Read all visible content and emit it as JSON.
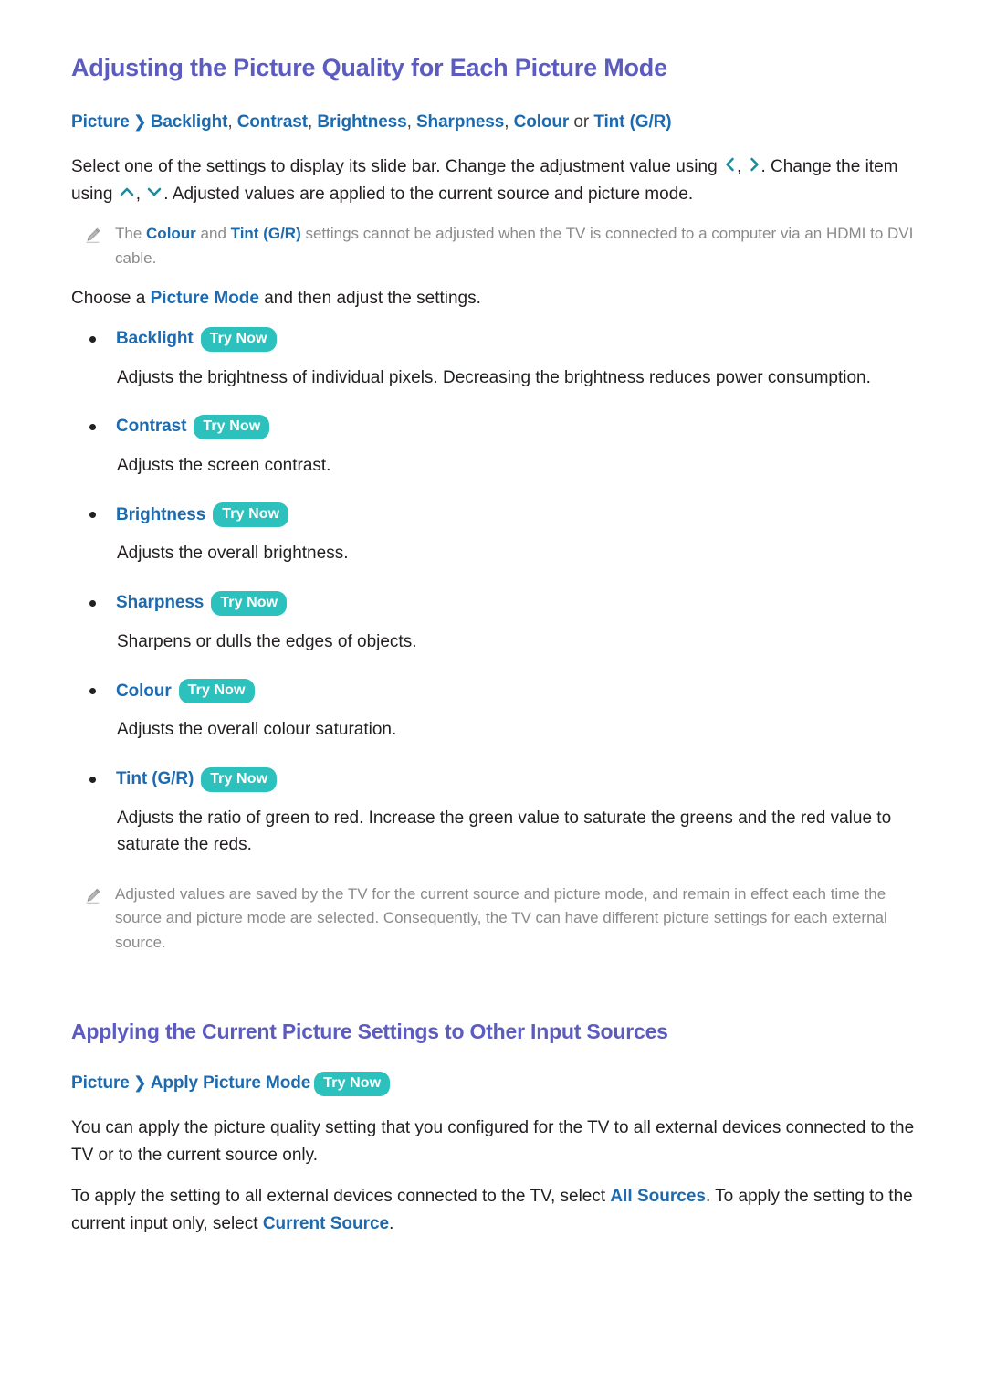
{
  "document": {
    "badge_label": "Try Now",
    "colors": {
      "heading": "#5b5bc0",
      "link_blue": "#1c6bb0",
      "badge_teal": "#2cc1bd",
      "chevron_teal": "#1a8c9e",
      "note_gray": "#8a8a8a",
      "body_text": "#231f20",
      "background": "#ffffff"
    }
  },
  "section1": {
    "heading": "Adjusting the Picture Quality for Each Picture Mode",
    "path": {
      "root": "Picture",
      "separator": "❯",
      "items": [
        "Backlight",
        "Contrast",
        "Brightness",
        "Sharpness",
        "Colour"
      ],
      "conjunction": "or",
      "last": "Tint (G/R)"
    },
    "intro": {
      "part1": "Select one of the settings to display its slide bar. Change the adjustment value using ",
      "arrow_left": "left-chevron-icon",
      "comma1": ", ",
      "arrow_right": "right-chevron-icon",
      "part2": ". Change the item using ",
      "arrow_up": "up-chevron-icon",
      "comma2": ", ",
      "arrow_down": "down-chevron-icon",
      "part3": ". Adjusted values are applied to the current source and picture mode."
    },
    "note1": {
      "icon": "pencil-icon",
      "part1": "The ",
      "term1": "Colour",
      "part2": " and ",
      "term2": "Tint (G/R)",
      "part3": " settings cannot be adjusted when the TV is connected to a computer via an HDMI to DVI cable."
    },
    "choose": {
      "part1": "Choose a ",
      "term": "Picture Mode",
      "part2": " and then adjust the settings."
    },
    "options": [
      {
        "label": "Backlight",
        "badge": "Try Now",
        "description": "Adjusts the brightness of individual pixels. Decreasing the brightness reduces power consumption."
      },
      {
        "label": "Contrast",
        "badge": "Try Now",
        "description": "Adjusts the screen contrast."
      },
      {
        "label": "Brightness",
        "badge": "Try Now",
        "description": "Adjusts the overall brightness."
      },
      {
        "label": "Sharpness",
        "badge": "Try Now",
        "description": "Sharpens or dulls the edges of objects."
      },
      {
        "label": "Colour",
        "badge": "Try Now",
        "description": "Adjusts the overall colour saturation."
      },
      {
        "label": "Tint (G/R)",
        "badge": "Try Now",
        "description": "Adjusts the ratio of green to red. Increase the green value to saturate the greens and the red value to saturate the reds."
      }
    ],
    "note2": {
      "icon": "pencil-icon",
      "text": "Adjusted values are saved by the TV for the current source and picture mode, and remain in effect each time the source and picture mode are selected. Consequently, the TV can have different picture settings for each external source."
    }
  },
  "section2": {
    "heading": "Applying the Current Picture Settings to Other Input Sources",
    "path": {
      "root": "Picture",
      "separator": "❯",
      "item": "Apply Picture Mode",
      "badge": "Try Now"
    },
    "paragraph1": "You can apply the picture quality setting that you configured for the TV to all external devices connected to the TV or to the current source only.",
    "paragraph2": {
      "part1": "To apply the setting to all external devices connected to the TV, select ",
      "term1": "All Sources",
      "part2": ". To apply the setting to the current input only, select ",
      "term2": "Current Source",
      "part3": "."
    }
  }
}
